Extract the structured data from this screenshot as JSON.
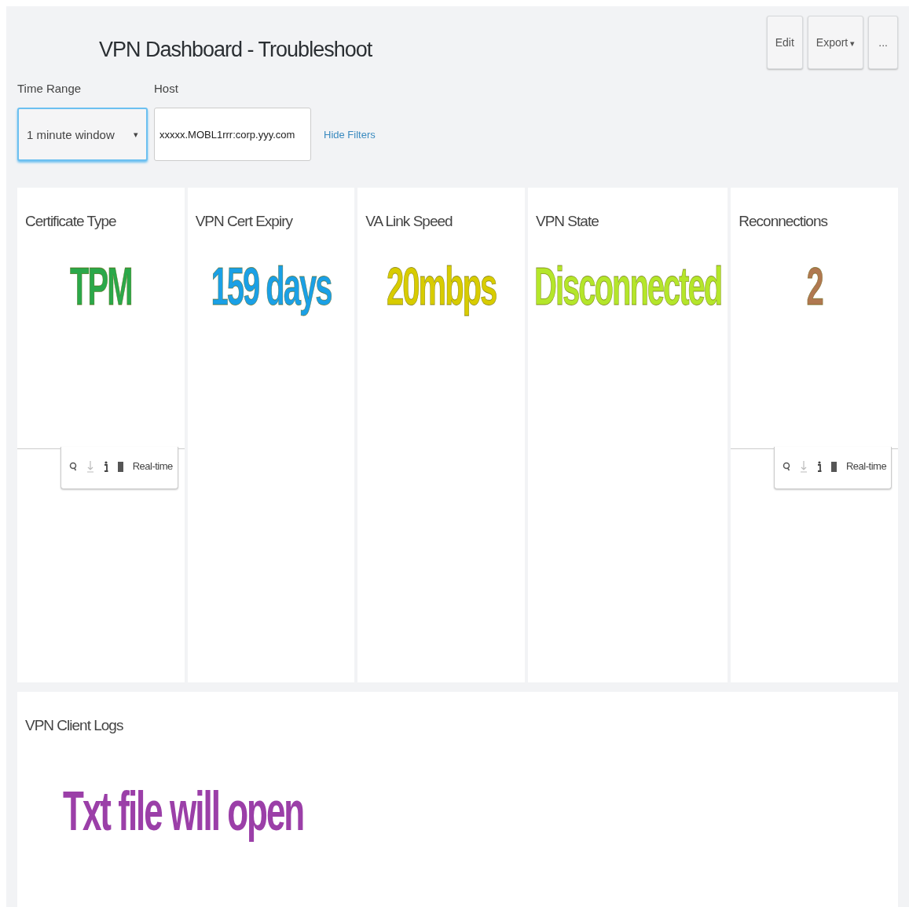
{
  "title": "VPN Dashboard - Troubleshoot",
  "actions": [
    {
      "label": "Edit",
      "kind": "plain"
    },
    {
      "label": "Export",
      "kind": "dropdown",
      "caret": "▾"
    },
    {
      "label": "...",
      "kind": "plain"
    }
  ],
  "filters": [
    {
      "label": "Time Range",
      "kind": "select",
      "value": "1 minute window",
      "caret": "▾",
      "focused": true
    },
    {
      "label": "Host",
      "kind": "text",
      "value": "xxxxx.MOBL1rrr:corp.yyy.com",
      "focused": false
    }
  ],
  "hide_filters": "Hide Filters",
  "panels": [
    {
      "title": "Certificate Type",
      "value": "TPM",
      "color": "#2ba84a",
      "toolbar": true,
      "toolbar_label": "Real-time"
    },
    {
      "title": "VPN Cert Expiry",
      "value": "159 days",
      "color": "#1aa0e6",
      "toolbar": false
    },
    {
      "title": "VA Link Speed",
      "value": "20mbps",
      "color": "#d8cc00",
      "toolbar": false
    },
    {
      "title": "VPN State",
      "value": "Disconnected",
      "color": "#b4e62a",
      "toolbar": false
    },
    {
      "title": "Reconnections",
      "value": "2",
      "color": "#b07850",
      "toolbar": true,
      "toolbar_label": "Real-time"
    }
  ],
  "logs": {
    "title": "VPN Client Logs",
    "value": "Txt file will open",
    "color": "#9b3fa8"
  }
}
